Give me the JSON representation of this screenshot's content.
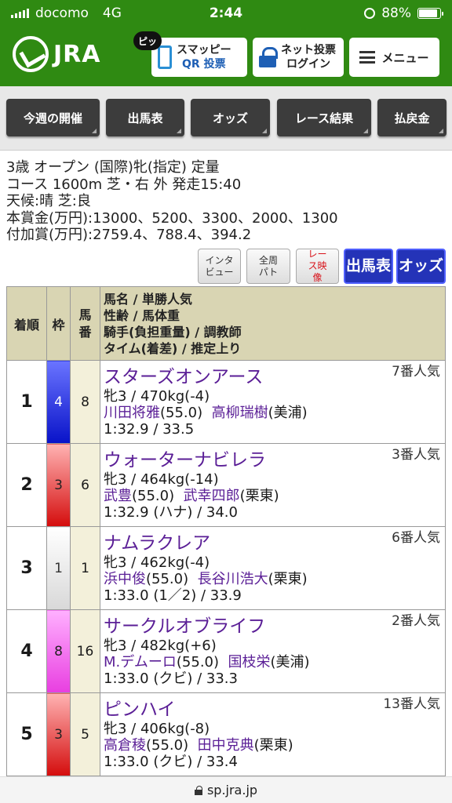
{
  "status": {
    "carrier": "docomo",
    "network": "4G",
    "time": "2:44",
    "battery": "88%"
  },
  "header": {
    "logo": "JRA",
    "badge": "ピッ",
    "qr_line1": "スマッピー",
    "qr_line2": "QR 投票",
    "login_line1": "ネット投票",
    "login_line2": "ログイン",
    "menu_label": "メニュー"
  },
  "nav": [
    "今週の開催",
    "出馬表",
    "オッズ",
    "レース結果",
    "払戻金"
  ],
  "race": {
    "line1": "3歳 オープン (国際)牝(指定) 定量",
    "line2": "コース 1600m 芝・右 外 発走15:40",
    "line3": "天候:晴 芝:良",
    "line4": "本賞金(万円):13000、5200、3300、2000、1300",
    "line5": "付加賞(万円):2759.4、788.4、394.2"
  },
  "actions": {
    "interview": "インタビュー",
    "patrol": "全周パト",
    "video": "レース映像",
    "entries": "出馬表",
    "odds": "オッズ"
  },
  "table": {
    "headers": {
      "rank": "着順",
      "frame": "枠",
      "num": "馬番",
      "info_l1": "馬名 / 単勝人気",
      "info_l2": "性齢 / 馬体重",
      "info_l3": "騎手(負担重量) / 調教師",
      "info_l4": "タイム(着差) / 推定上り"
    },
    "rows": [
      {
        "rank": "1",
        "frame": "4",
        "num": "8",
        "name": "スターズオンアース",
        "pop": "7番人気",
        "sex_weight": "牝3 / 470kg(-4)",
        "jockey": "川田将雅",
        "load": "(55.0)",
        "trainer": "高柳瑞樹",
        "stable": "(美浦)",
        "time": "1:32.9 / 33.5"
      },
      {
        "rank": "2",
        "frame": "3",
        "num": "6",
        "name": "ウォーターナビレラ",
        "pop": "3番人気",
        "sex_weight": "牝3 / 464kg(-14)",
        "jockey": "武豊",
        "load": "(55.0)",
        "trainer": "武幸四郎",
        "stable": "(栗東)",
        "time": "1:32.9 (ハナ) / 34.0"
      },
      {
        "rank": "3",
        "frame": "1",
        "num": "1",
        "name": "ナムラクレア",
        "pop": "6番人気",
        "sex_weight": "牝3 / 462kg(-4)",
        "jockey": "浜中俊",
        "load": "(55.0)",
        "trainer": "長谷川浩大",
        "stable": "(栗東)",
        "time": "1:33.0 (1／2) / 33.9"
      },
      {
        "rank": "4",
        "frame": "8",
        "num": "16",
        "name": "サークルオブライフ",
        "pop": "2番人気",
        "sex_weight": "牝3 / 482kg(+6)",
        "jockey": "M.デムーロ",
        "load": "(55.0)",
        "trainer": "国枝栄",
        "stable": "(美浦)",
        "time": "1:33.0 (クビ) / 33.3"
      },
      {
        "rank": "5",
        "frame": "3",
        "num": "5",
        "name": "ピンハイ",
        "pop": "13番人気",
        "sex_weight": "牝3 / 406kg(-8)",
        "jockey": "高倉稜",
        "load": "(55.0)",
        "trainer": "田中克典",
        "stable": "(栗東)",
        "time": "1:33.0 (クビ) / 33.4"
      }
    ]
  },
  "url": "sp.jra.jp"
}
